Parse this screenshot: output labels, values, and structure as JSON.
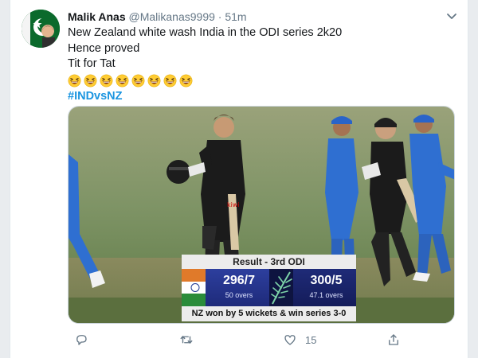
{
  "author": {
    "name": "Malik Anas",
    "handle": "@Malikanas9999",
    "separator": "·",
    "time": "51m"
  },
  "tweet": {
    "lines": [
      "New Zealand white wash India in the ODI series 2k20",
      "Hence proved",
      "Tit for Tat"
    ],
    "emoji": [
      "grinning-squinting-face",
      "grinning-squinting-face",
      "grinning-squinting-face",
      "grinning-squinting-face",
      "grinning-squinting-face",
      "grinning-squinting-face",
      "grinning-squinting-face",
      "grinning-squinting-face"
    ],
    "hashtag": "#INDvsNZ"
  },
  "media": {
    "scoreboard": {
      "title": "Result - 3rd ODI",
      "team1": {
        "flag_icon": "india-flag-icon",
        "score": "296/7",
        "overs": "50 overs"
      },
      "team2": {
        "flag_icon": "silver-fern-icon",
        "score": "300/5",
        "overs": "47.1 overs"
      },
      "result": "NZ won by 5 wickets & win series 3-0"
    }
  },
  "actions": {
    "reply_icon": "reply-icon",
    "retweet_icon": "retweet-icon",
    "like_icon": "heart-icon",
    "like_count": "15",
    "share_icon": "share-icon"
  },
  "colors": {
    "link": "#1b95e0",
    "text": "#14171a",
    "secondary": "#657786"
  }
}
